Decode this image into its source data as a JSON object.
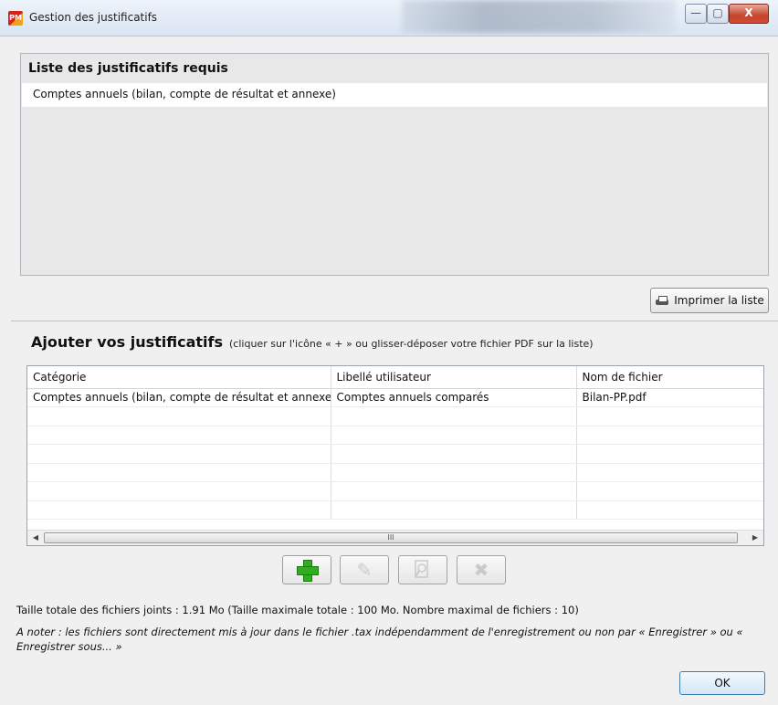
{
  "window": {
    "title": "Gestion des justificatifs",
    "app_icon_text": "PM",
    "controls": {
      "minimize": "—",
      "maximize": "▢",
      "close": "X"
    }
  },
  "required_list": {
    "heading": "Liste des justificatifs requis",
    "items": [
      "Comptes annuels (bilan, compte de résultat et annexe)"
    ],
    "print_button": "Imprimer la liste"
  },
  "attachments": {
    "heading": "Ajouter vos justificatifs",
    "hint": "(cliquer sur l'icône « + » ou glisser-déposer votre fichier PDF sur la liste)",
    "columns": [
      "Catégorie",
      "Libellé utilisateur",
      "Nom de fichier"
    ],
    "rows": [
      [
        "Comptes annuels (bilan, compte de résultat et annexe)",
        "Comptes annuels comparés",
        "Bilan-PP.pdf"
      ]
    ],
    "scrollbar_grip": "III"
  },
  "toolbar": {
    "add_icon": "plus-icon",
    "edit_icon": "pencil-icon",
    "view_icon": "magnifier-icon",
    "delete_icon": "x-icon"
  },
  "footer": {
    "total_size": "Taille totale des fichiers joints :  1.91 Mo (Taille maximale totale : 100 Mo. Nombre maximal de fichiers : 10)",
    "note": "A noter : les fichiers sont directement mis à jour dans le fichier .tax indépendamment de l'enregistrement ou non par « Enregistrer » ou « Enregistrer sous... »",
    "ok_button": "OK"
  }
}
